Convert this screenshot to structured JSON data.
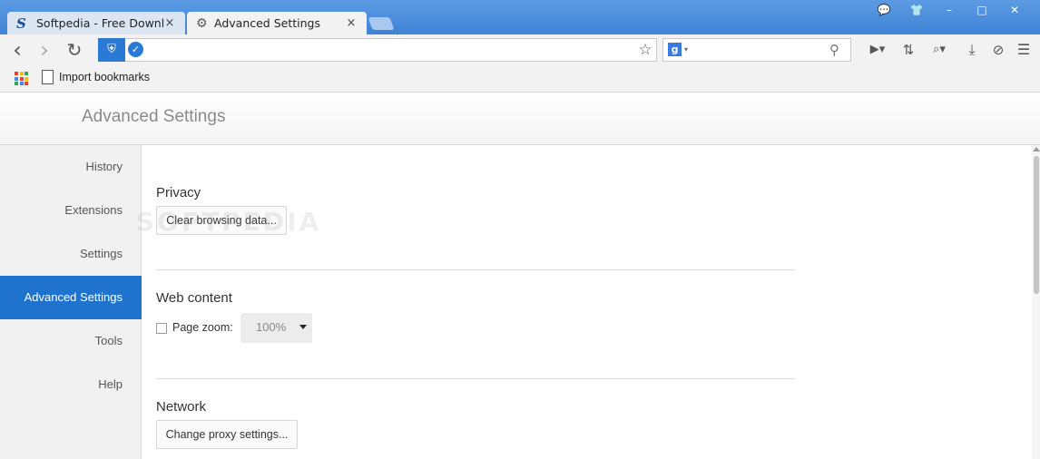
{
  "tabs": [
    {
      "label": "Softpedia - Free Download",
      "icon": "softpedia-logo-icon",
      "close": "×"
    },
    {
      "label": "Advanced Settings",
      "icon": "gear-icon",
      "close": "×"
    }
  ],
  "window_controls": {
    "feedback": "💬",
    "skin": "👕",
    "minimize": "–",
    "maximize": "□",
    "close": "✕"
  },
  "toolbar": {
    "back": "‹",
    "forward": "›",
    "reload": "↻",
    "shield": "⛨",
    "verified": "✓",
    "address_value": "",
    "star": "☆",
    "search_engine": "g",
    "search_engine_caret": "▾",
    "search_placeholder": "",
    "search_icon": "⚲",
    "extra_icons": [
      "▶▾",
      "⇅",
      "⌕▾",
      "⤓",
      "⊘",
      "☰"
    ]
  },
  "bookmarks": {
    "apps_colors": [
      "#e94235",
      "#fbbc04",
      "#34a853",
      "#4285f4",
      "#e94235",
      "#fbbc04",
      "#34a853",
      "#4285f4",
      "#e94235"
    ],
    "import_label": "Import bookmarks"
  },
  "page": {
    "title": "Advanced Settings"
  },
  "sidebar": {
    "items": [
      {
        "label": "History",
        "active": false
      },
      {
        "label": "Extensions",
        "active": false
      },
      {
        "label": "Settings",
        "active": false
      },
      {
        "label": "Advanced Settings",
        "active": true
      },
      {
        "label": "Tools",
        "active": false
      },
      {
        "label": "Help",
        "active": false
      }
    ]
  },
  "privacy": {
    "title": "Privacy",
    "clear_button": "Clear browsing data..."
  },
  "web_content": {
    "title": "Web content",
    "page_zoom_label": "Page zoom:",
    "page_zoom_checked": false,
    "page_zoom_value": "100%"
  },
  "network": {
    "title": "Network",
    "proxy_button": "Change proxy settings..."
  },
  "watermark": "SOFTPEDIA",
  "colors": {
    "accent": "#1f73cf",
    "titlebar": "#4a8ddc"
  }
}
